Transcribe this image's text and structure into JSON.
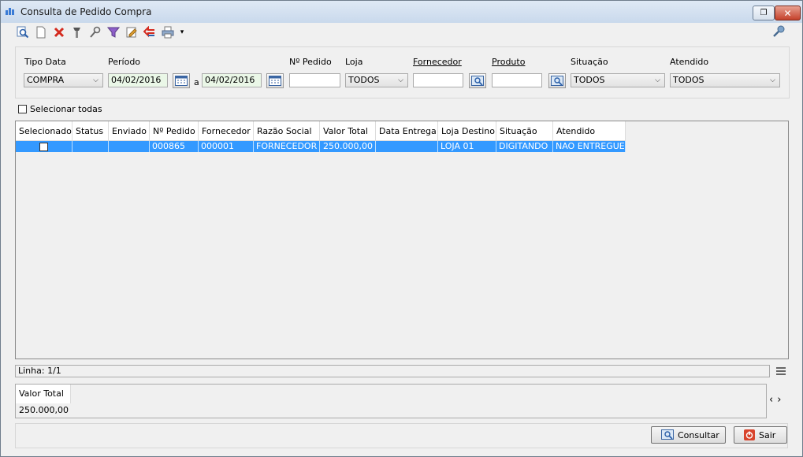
{
  "window": {
    "title": "Consulta de Pedido Compra",
    "close_glyph": "✕",
    "restore_glyph": "❐"
  },
  "toolbar": {
    "icons": [
      "search-doc-icon",
      "new-doc-icon",
      "delete-icon",
      "tools-icon",
      "key-tools-icon",
      "filter-icon",
      "edit-icon",
      "back-icon",
      "print-icon"
    ],
    "dropdown_glyph": "▾"
  },
  "filters": {
    "tipo_data_label": "Tipo Data",
    "tipo_data_value": "COMPRA",
    "periodo_label": "Período",
    "periodo_start": "04/02/2016",
    "periodo_sep": "a",
    "periodo_end": "04/02/2016",
    "pedido_label": "Nº Pedido",
    "pedido_value": "",
    "loja_label": "Loja",
    "loja_value": "TODOS",
    "fornecedor_label": "Fornecedor",
    "fornecedor_value": "",
    "produto_label": "Produto",
    "produto_value": "",
    "situacao_label": "Situação",
    "situacao_value": "TODOS",
    "atendido_label": "Atendido",
    "atendido_value": "TODOS"
  },
  "select_all_label": "Selecionar todas",
  "grid": {
    "columns": [
      "Selecionado",
      "Status",
      "Enviado",
      "Nº Pedido",
      "Fornecedor",
      "Razão Social",
      "Valor Total",
      "Data Entrega",
      "Loja Destino",
      "Situação",
      "Atendido"
    ],
    "rows": [
      {
        "selecionado": "",
        "status": "",
        "enviado": "",
        "pedido": "000865",
        "fornecedor": "000001",
        "razao": "FORNECEDOR",
        "valor": "250.000,00",
        "entrega": "",
        "loja": "LOJA 01",
        "situacao": "DIGITANDO",
        "atendido": "NAO ENTREGUE"
      }
    ]
  },
  "status_bar": {
    "linha": "Linha: 1/1"
  },
  "totals": {
    "label": "Valor Total",
    "value": "250.000,00"
  },
  "nav": {
    "prev": "‹",
    "next": "›"
  },
  "buttons": {
    "consultar": "Consultar",
    "sair": "Sair"
  },
  "colors": {
    "selection": "#3399ff",
    "accent_close": "#c4412b"
  }
}
